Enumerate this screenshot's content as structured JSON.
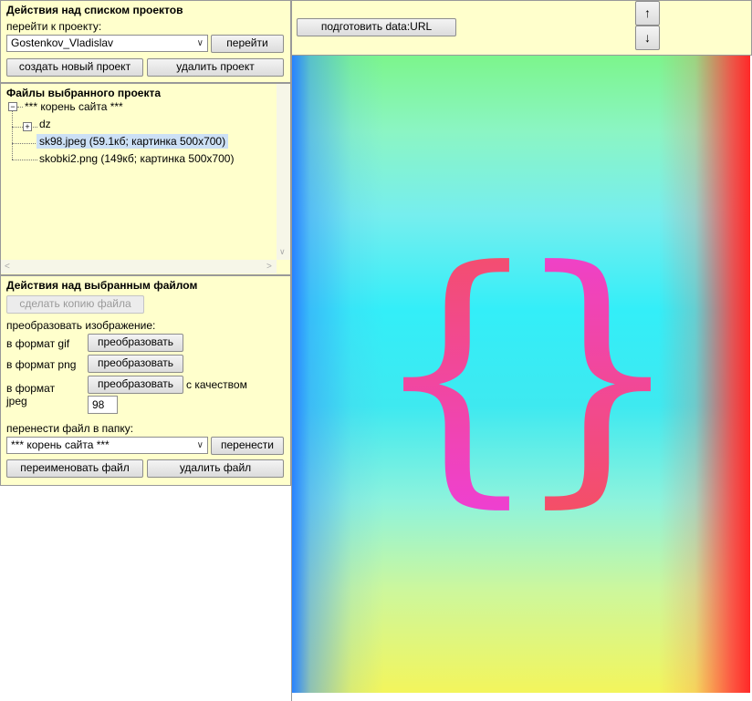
{
  "projects": {
    "header": "Действия над списком проектов",
    "goto_label": "перейти к проекту:",
    "selected_project": "Gostenkov_Vladislav",
    "goto_button": "перейти",
    "create_button": "создать новый проект",
    "delete_button": "удалить проект"
  },
  "files": {
    "header": "Файлы выбранного проекта",
    "root": "*** корень сайта ***",
    "items": [
      {
        "name": "dz",
        "type": "folder"
      },
      {
        "name": "sk98.jpeg (59.1кб; картинка 500x700)",
        "type": "file",
        "selected": true
      },
      {
        "name": "skobki2.png (149кб; картинка 500x700)",
        "type": "file"
      }
    ]
  },
  "file_actions": {
    "header": "Действия над выбранным файлом",
    "copy_button": "сделать копию файла",
    "convert_label": "преобразовать изображение:",
    "gif_label": "в формат gif",
    "png_label": "в формат png",
    "jpeg_label_1": "в формат",
    "jpeg_label_2": "jpeg",
    "convert_button": "преобразовать",
    "quality_label": "с качеством",
    "quality_value": "98",
    "move_label": "перенести файл в папку:",
    "move_target": "*** корень сайта ***",
    "move_button": "перенести",
    "rename_button": "переименовать файл",
    "delete_button": "удалить файл"
  },
  "toolbar": {
    "dataurl_button": "подготовить data:URL",
    "up_arrow": "↑",
    "down_arrow": "↓"
  },
  "preview": {
    "left_brace": "{",
    "right_brace": "}",
    "brace_colors": [
      "#f4505f",
      "#ee3fd8"
    ]
  }
}
